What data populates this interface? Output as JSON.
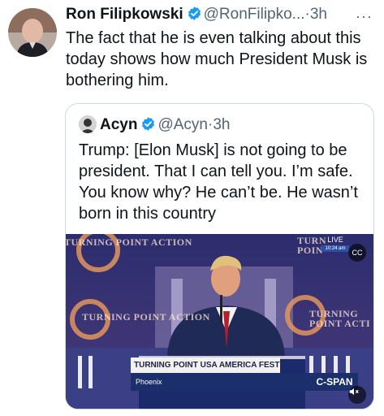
{
  "tweet": {
    "author_name": "Ron Filipkowski",
    "handle": "@RonFilipko...",
    "separator": "·",
    "time": "3h",
    "more_icon": "more-horizontal-icon",
    "text": "The fact that he is even talking about this today shows how much President Musk is bothering him."
  },
  "quote": {
    "author_name": "Acyn",
    "handle": "@Acyn",
    "separator": "·",
    "time": "3h",
    "text": "Trump: [Elon Musk] is not going to be president. That I can tell you. I’m safe. You know why? He can’t be. He wasn’t born in this country"
  },
  "video": {
    "backdrop_logos": [
      "TURNING POINT ACTION",
      "TURNING POINT ACTION",
      "TURNING POINT ACTI",
      "TURN POIN"
    ],
    "lower_third_title": "TURNING POINT USA AMERICA FEST",
    "lower_third_location": "Phoenix",
    "network": "C-SPAN",
    "live_label": "LIVE",
    "live_time": "10:24 am",
    "cc_label": "CC",
    "mute_icon": "volume-mute-icon"
  },
  "colors": {
    "verified_blue": "#1d9bf0",
    "secondary_text": "#536471",
    "border": "#cfd9de",
    "cspan_blue": "#1a2f6b"
  }
}
